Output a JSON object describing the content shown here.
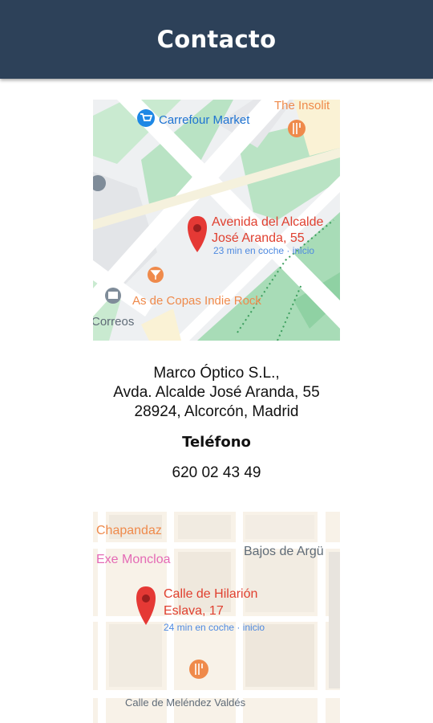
{
  "header": {
    "title": "Contacto"
  },
  "map1": {
    "poi_carrefour": "Carrefour Market",
    "poi_insolit": "The Insolit",
    "poi_bar": "As de Copas Indie Rock",
    "poi_correos": "Correos",
    "destination_line1": "Avenida del Alcalde",
    "destination_line2": "José Aranda, 55",
    "eta": "23 min en coche · inicio"
  },
  "contact": {
    "company": "Marco Óptico S.L.,",
    "street": "Avda. Alcalde José Aranda, 55",
    "city": "28924, Alcorcón, Madrid",
    "phone_label": "Teléfono",
    "phone": "620 02 43 49"
  },
  "map2": {
    "poi_chapandaz": "Chapandaz",
    "poi_exe": "Exe Moncloa",
    "poi_bajos": "Bajos de Argü",
    "destination_line1": "Calle de Hilarión",
    "destination_line2": "Eslava, 17",
    "eta": "24 min en coche · inicio",
    "street_label": "Calle de Meléndez Valdés"
  },
  "colors": {
    "header_bg": "#2d4159",
    "pin_red": "#e53935",
    "map_green": "#b7e4c7",
    "eta_blue": "#4f8ae0"
  }
}
